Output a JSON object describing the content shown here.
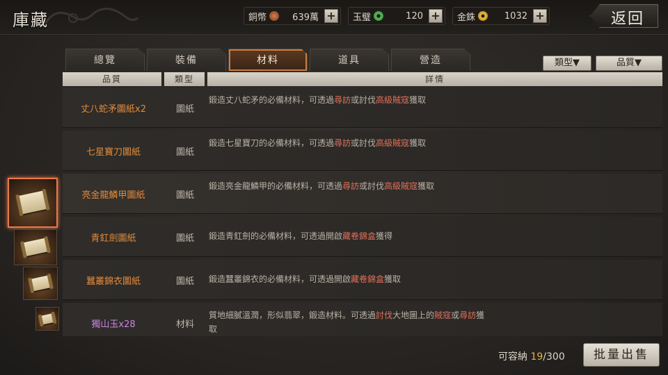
{
  "title": "庫藏",
  "back_label": "返回",
  "resources": [
    {
      "label": "銅幣",
      "value": "639萬",
      "coin_color": "#b0603a",
      "plus": "+"
    },
    {
      "label": "玉璧",
      "value": "120",
      "coin_color": "#4cae4c",
      "plus": "+"
    },
    {
      "label": "金銖",
      "value": "1032",
      "coin_color": "#d8a830",
      "plus": "+"
    }
  ],
  "tabs": [
    {
      "label": "總覽",
      "active": false
    },
    {
      "label": "裝備",
      "active": false
    },
    {
      "label": "材料",
      "active": true
    },
    {
      "label": "道具",
      "active": false
    },
    {
      "label": "營造",
      "active": false
    }
  ],
  "filters": {
    "type_label": "類型▼",
    "quality_label": "品質▼"
  },
  "columns": {
    "quality": "品質",
    "type": "類型",
    "detail": "詳情"
  },
  "rows": [
    {
      "name": "丈八蛇矛圖紙x2",
      "type": "圖紙",
      "d1": "鍛造丈八蛇矛的必備材料，可透過",
      "h1": "尋訪",
      "d2": "或討伐",
      "h2": "高級賊寇",
      "d3": "獲取",
      "color": "orange"
    },
    {
      "name": "七星寶刀圖紙",
      "type": "圖紙",
      "d1": "鍛造七星寶刀的必備材料，可透過",
      "h1": "尋訪",
      "d2": "或討伐",
      "h2": "高級賊寇",
      "d3": "獲取",
      "color": "orange"
    },
    {
      "name": "亮金龍鱗甲圖紙",
      "type": "圖紙",
      "d1": "鍛造亮金龍鱗甲的必備材料，可透過",
      "h1": "尋訪",
      "d2": "或討伐",
      "h2": "高級賊寇",
      "d3": "獲取",
      "color": "orange"
    },
    {
      "name": "青釭劍圖紙",
      "type": "圖紙",
      "d1": "鍛造青釭劍的必備材料，可透過開啟",
      "h1": "藏卷錦盒",
      "d2": "獲得",
      "h2": "",
      "d3": "",
      "color": "orange"
    },
    {
      "name": "蠶叢錦衣圖紙",
      "type": "圖紙",
      "d1": "鍛造蠶叢錦衣的必備材料，可透過開啟",
      "h1": "藏卷錦盒",
      "d2": "獲取",
      "h2": "",
      "d3": "",
      "color": "orange"
    },
    {
      "name": "獨山玉x28",
      "type": "材料",
      "d1": "質地細膩溫潤，形似翡翠，鍛造材料。可透過",
      "h1": "討伐",
      "d2": "大地圖上的",
      "h2": "賊寇",
      "d3": "或",
      "h3": "尋訪",
      "d4": "獲取",
      "color": "purple"
    }
  ],
  "capacity": {
    "label": "可容納",
    "count": "19",
    "total": "/300"
  },
  "sell_label": "批量出售"
}
